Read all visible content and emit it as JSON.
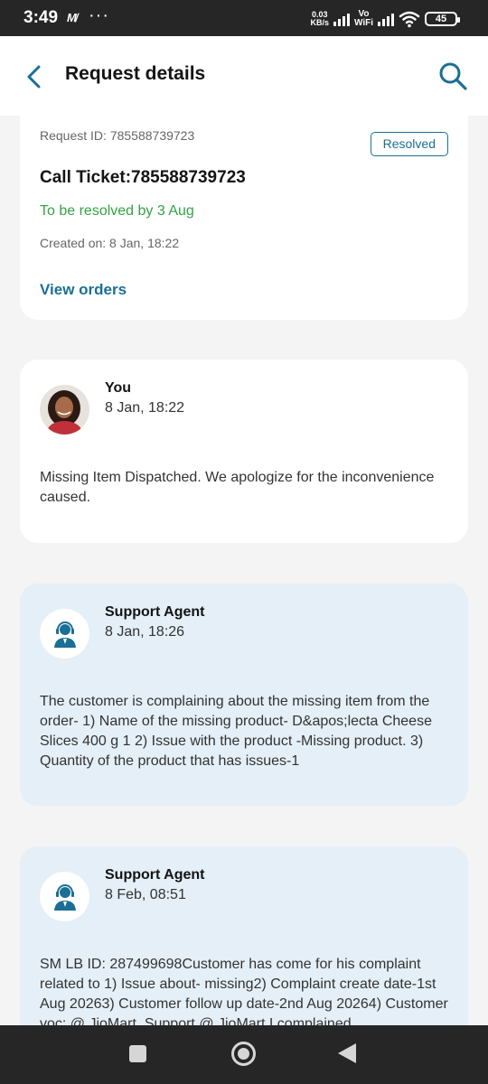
{
  "status_bar": {
    "time": "3:49",
    "net_speed_value": "0.03",
    "net_speed_unit": "KB/s",
    "vo": "Vo",
    "wifi": "WiFi",
    "battery": "45",
    "icons": [
      "notification-app-icon",
      "more-dots-icon",
      "signal-icon",
      "wifi-icon",
      "battery-icon"
    ]
  },
  "header": {
    "title": "Request details",
    "back_icon": "chevron-left-icon",
    "search_icon": "search-icon",
    "accent_color": "#1b6f95"
  },
  "summary": {
    "request_id": "Request ID: 785588739723",
    "status": "Resolved",
    "ticket_title": "Call Ticket:785588739723",
    "resolve_by": "To be resolved by 3 Aug",
    "created_on": "Created on: 8 Jan, 18:22",
    "view_orders": "View orders",
    "resolve_color": "#35a245"
  },
  "messages": [
    {
      "sender": "You",
      "time": "8 Jan, 18:22",
      "text": "Missing Item Dispatched. We apologize for the inconvenience caused."
    },
    {
      "sender": "Support Agent",
      "time": "8 Jan, 18:26",
      "text": "The customer is complaining about the missing item from the order- 1) Name of the missing product- D&apos;lecta Cheese Slices 400 g 1 2) Issue with the product -Missing product. 3) Quantity of the product that has issues-1"
    },
    {
      "sender": "Support Agent",
      "time": "8 Feb, 08:51",
      "text": "SM LB ID: 287499698Customer has come for his complaint related to 1) Issue about- missing2) Complaint create date-1st Aug 20263) Customer follow up date-2nd Aug 20264) Customer voc: @ JioMart_Support @ JioMart I complained"
    }
  ],
  "nav_bar": {
    "icons": [
      "recent-apps-icon",
      "home-icon",
      "back-triangle-icon"
    ]
  }
}
